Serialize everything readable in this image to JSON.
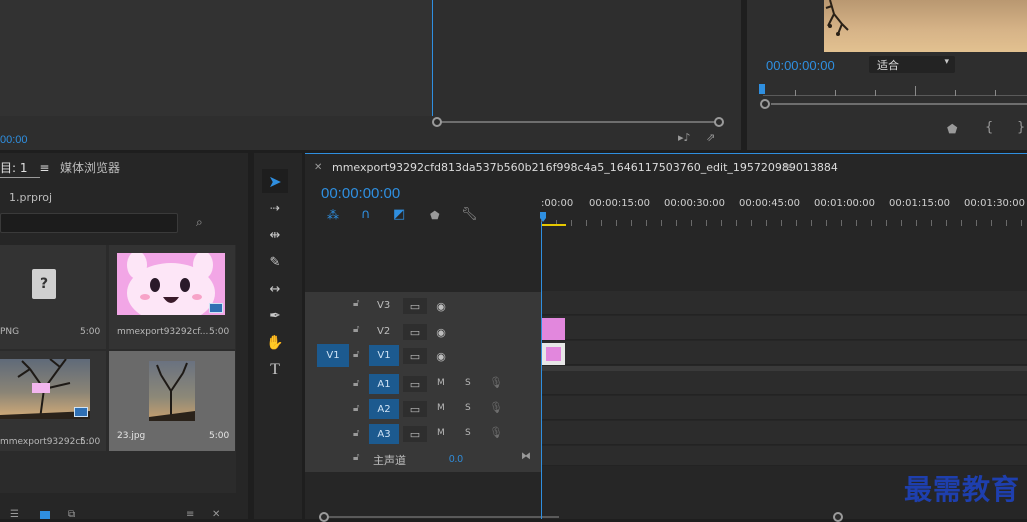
{
  "source_monitor": {
    "timecode": "00:00"
  },
  "program_monitor": {
    "timecode": "00:00:00:00",
    "fit_label": "适合"
  },
  "project": {
    "tab_label": "目: 1",
    "tab_media_browser": "媒体浏览器",
    "filename": "1.prproj"
  },
  "media": [
    {
      "name": "PNG",
      "duration": "5:00",
      "type": "missing"
    },
    {
      "name": "mmexport93292cf...",
      "duration": "5:00",
      "type": "anime"
    },
    {
      "name": "mmexport93292cf...",
      "duration": "5:00",
      "type": "tree"
    },
    {
      "name": "23.jpg",
      "duration": "5:00",
      "type": "tree-tall"
    }
  ],
  "sequence": {
    "name": "mmexport93292cfd813da537b560b216f998c4a5_1646117503760_edit_195720989013884",
    "timecode": "00:00:00:00",
    "ruler": [
      ":00:00",
      "00:00:15:00",
      "00:00:30:00",
      "00:00:45:00",
      "00:01:00:00",
      "00:01:15:00",
      "00:01:30:00"
    ]
  },
  "tracks": {
    "video": [
      {
        "name": "V3"
      },
      {
        "name": "V2"
      },
      {
        "name": "V1",
        "source": "V1"
      }
    ],
    "audio": [
      {
        "name": "A1",
        "m": "M",
        "s": "S"
      },
      {
        "name": "A2",
        "m": "M",
        "s": "S"
      },
      {
        "name": "A3",
        "m": "M",
        "s": "S"
      }
    ],
    "master": {
      "label": "主声道",
      "value": "0.0"
    }
  },
  "watermark": "最需教育",
  "colors": {
    "accent": "#2f8fe0",
    "clip": "#e287dd",
    "track_blue": "#1c5a8f"
  }
}
